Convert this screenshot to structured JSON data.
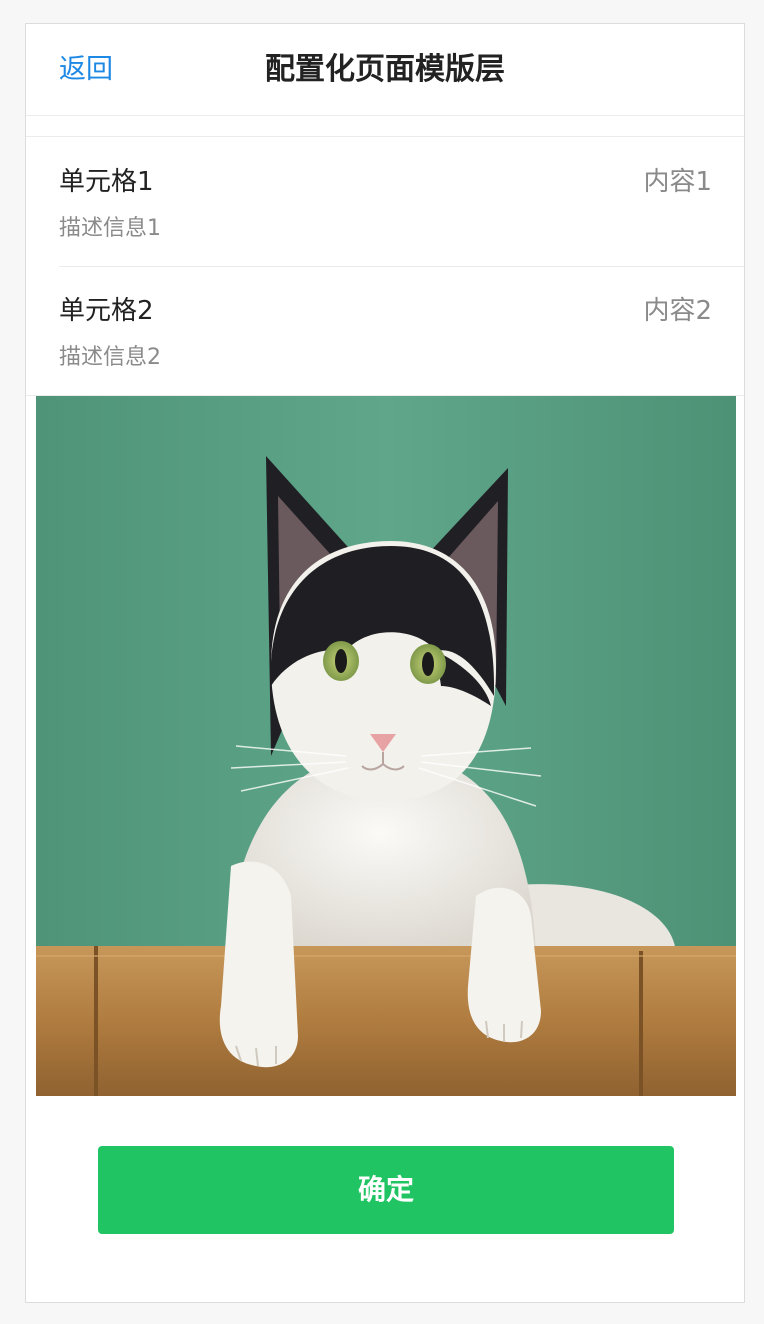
{
  "navbar": {
    "back_label": "返回",
    "title": "配置化页面模版层"
  },
  "cells": [
    {
      "title": "单元格1",
      "description": "描述信息1",
      "value": "内容1"
    },
    {
      "title": "单元格2",
      "description": "描述信息2",
      "value": "内容2"
    }
  ],
  "photo": {
    "subject": "cat-photo",
    "background_color": "#5a9c82",
    "ledge_color": "#b9874a"
  },
  "actions": {
    "confirm_label": "确定",
    "confirm_color": "#20c463"
  },
  "colors": {
    "link": "#1e88e5",
    "primary_text": "#222222",
    "secondary_text": "#8a8a8a"
  }
}
